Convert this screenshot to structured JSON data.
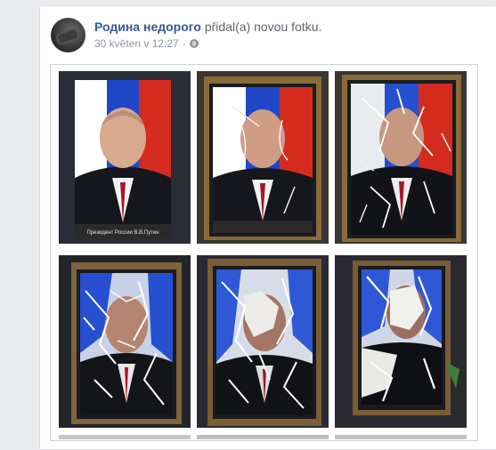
{
  "post": {
    "author": "Родина недорого",
    "action": " přidal(a) novou fotku.",
    "timestamp": "30 květen v 12:27",
    "separator": "·",
    "privacy_icon": "globe-icon"
  },
  "photos": [
    {
      "label": "Президент России В.В.Путин",
      "state": "intact"
    },
    {
      "label": "",
      "state": "light-damage"
    },
    {
      "label": "",
      "state": "medium-damage"
    },
    {
      "label": "",
      "state": "heavy-damage"
    },
    {
      "label": "",
      "state": "heavy-damage"
    },
    {
      "label": "",
      "state": "destroyed"
    }
  ],
  "colors": {
    "author": "#365899",
    "meta": "#90949c",
    "flag_white": "#ffffff",
    "flag_blue": "#1f47c8",
    "flag_red": "#d52b1e"
  }
}
